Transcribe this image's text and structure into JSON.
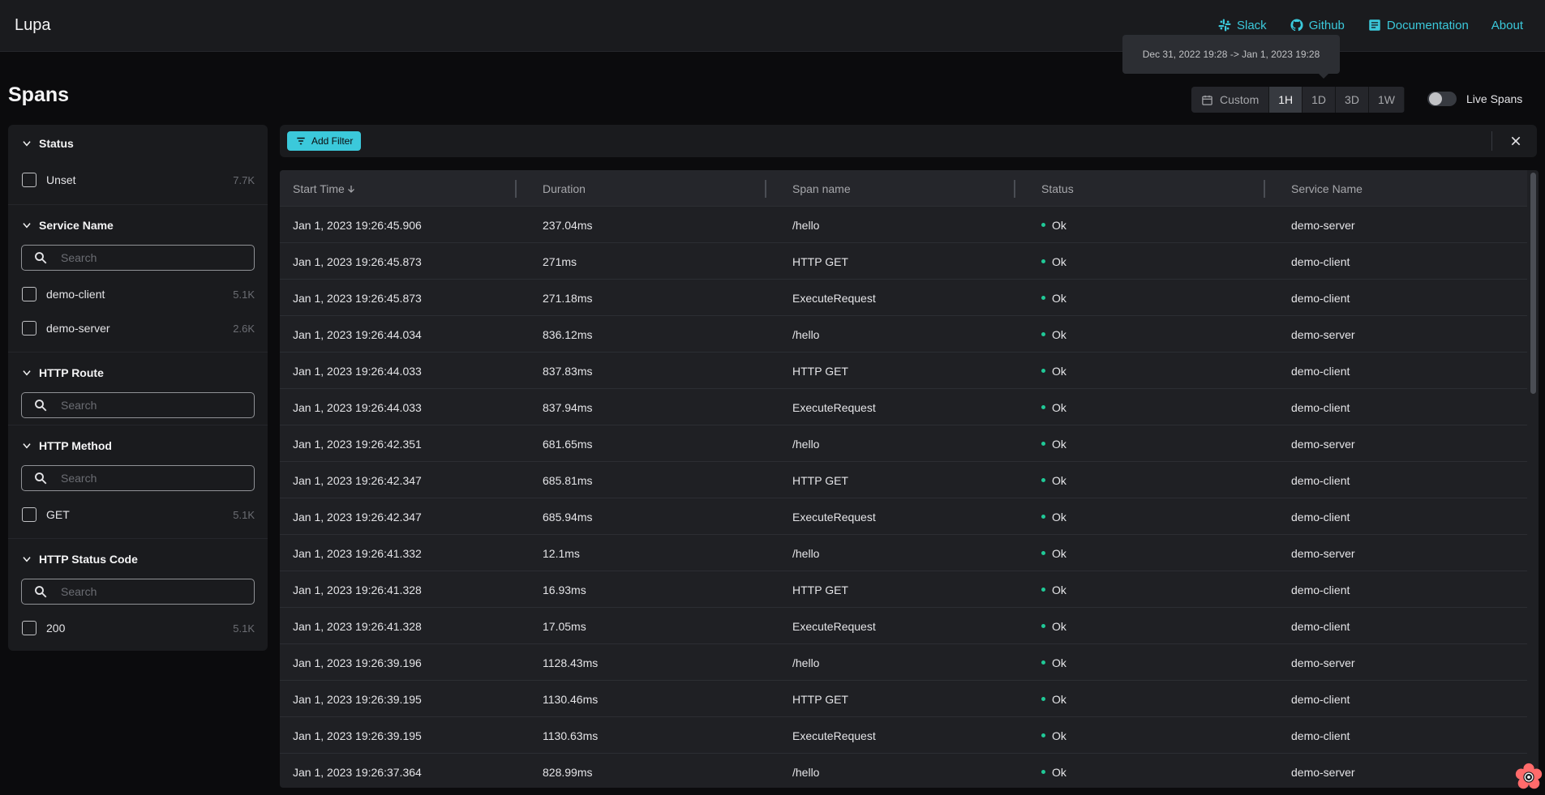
{
  "app": {
    "title": "Lupa"
  },
  "nav": [
    {
      "label": "Slack",
      "icon": "slack-icon"
    },
    {
      "label": "Github",
      "icon": "github-icon"
    },
    {
      "label": "Documentation",
      "icon": "document-icon"
    },
    {
      "label": "About",
      "icon": ""
    }
  ],
  "tooltip": {
    "text": "Dec 31, 2022 19:28 -> Jan 1, 2023 19:28"
  },
  "page": {
    "title": "Spans"
  },
  "range": {
    "custom_label": "Custom",
    "options": [
      "1H",
      "1D",
      "3D",
      "1W"
    ],
    "selected": "1H"
  },
  "live": {
    "label": "Live Spans",
    "enabled": false
  },
  "sidebar": {
    "status": {
      "title": "Status",
      "items": [
        {
          "label": "Unset",
          "count": "7.7K"
        }
      ]
    },
    "service_name": {
      "title": "Service Name",
      "placeholder": "Search",
      "items": [
        {
          "label": "demo-client",
          "count": "5.1K"
        },
        {
          "label": "demo-server",
          "count": "2.6K"
        }
      ]
    },
    "http_route": {
      "title": "HTTP Route",
      "placeholder": "Search"
    },
    "http_method": {
      "title": "HTTP Method",
      "placeholder": "Search",
      "items": [
        {
          "label": "GET",
          "count": "5.1K"
        }
      ]
    },
    "http_status": {
      "title": "HTTP Status Code",
      "placeholder": "Search",
      "items": [
        {
          "label": "200",
          "count": "5.1K"
        }
      ]
    }
  },
  "filterbar": {
    "add_label": "Add Filter"
  },
  "table": {
    "columns": [
      "Start Time",
      "Duration",
      "Span name",
      "Status",
      "Service Name"
    ],
    "sort_column": "Start Time",
    "sort_direction": "desc",
    "rows": [
      [
        "Jan 1, 2023 19:26:45.906",
        "237.04ms",
        "/hello",
        "Ok",
        "demo-server"
      ],
      [
        "Jan 1, 2023 19:26:45.873",
        "271ms",
        "HTTP GET",
        "Ok",
        "demo-client"
      ],
      [
        "Jan 1, 2023 19:26:45.873",
        "271.18ms",
        "ExecuteRequest",
        "Ok",
        "demo-client"
      ],
      [
        "Jan 1, 2023 19:26:44.034",
        "836.12ms",
        "/hello",
        "Ok",
        "demo-server"
      ],
      [
        "Jan 1, 2023 19:26:44.033",
        "837.83ms",
        "HTTP GET",
        "Ok",
        "demo-client"
      ],
      [
        "Jan 1, 2023 19:26:44.033",
        "837.94ms",
        "ExecuteRequest",
        "Ok",
        "demo-client"
      ],
      [
        "Jan 1, 2023 19:26:42.351",
        "681.65ms",
        "/hello",
        "Ok",
        "demo-server"
      ],
      [
        "Jan 1, 2023 19:26:42.347",
        "685.81ms",
        "HTTP GET",
        "Ok",
        "demo-client"
      ],
      [
        "Jan 1, 2023 19:26:42.347",
        "685.94ms",
        "ExecuteRequest",
        "Ok",
        "demo-client"
      ],
      [
        "Jan 1, 2023 19:26:41.332",
        "12.1ms",
        "/hello",
        "Ok",
        "demo-server"
      ],
      [
        "Jan 1, 2023 19:26:41.328",
        "16.93ms",
        "HTTP GET",
        "Ok",
        "demo-client"
      ],
      [
        "Jan 1, 2023 19:26:41.328",
        "17.05ms",
        "ExecuteRequest",
        "Ok",
        "demo-client"
      ],
      [
        "Jan 1, 2023 19:26:39.196",
        "1128.43ms",
        "/hello",
        "Ok",
        "demo-server"
      ],
      [
        "Jan 1, 2023 19:26:39.195",
        "1130.46ms",
        "HTTP GET",
        "Ok",
        "demo-client"
      ],
      [
        "Jan 1, 2023 19:26:39.195",
        "1130.63ms",
        "ExecuteRequest",
        "Ok",
        "demo-client"
      ],
      [
        "Jan 1, 2023 19:26:37.364",
        "828.99ms",
        "/hello",
        "Ok",
        "demo-server"
      ]
    ]
  },
  "colors": {
    "accent": "#3bc9db",
    "status_ok": "#20c997",
    "background": "#0b0b0d",
    "panel": "#1a1b1e"
  }
}
